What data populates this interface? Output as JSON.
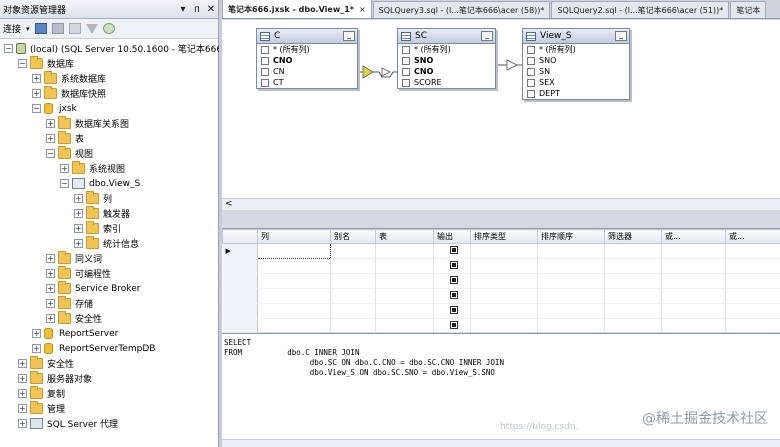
{
  "object_explorer": {
    "title": "对象资源管理器",
    "ctrl_pin": "▾",
    "ctrl_dock": "ᴨ",
    "ctrl_close": "✕",
    "connect_label": "连接",
    "tree": [
      {
        "label": "(local) (SQL Server 10.50.1600 - 笔记本666\\",
        "indent": 0,
        "exp": "−",
        "icon": "server"
      },
      {
        "label": "数据库",
        "indent": 1,
        "exp": "−",
        "icon": "folder"
      },
      {
        "label": "系统数据库",
        "indent": 2,
        "exp": "+",
        "icon": "folder"
      },
      {
        "label": "数据库快照",
        "indent": 2,
        "exp": "+",
        "icon": "folder"
      },
      {
        "label": "jxsk",
        "indent": 2,
        "exp": "−",
        "icon": "db"
      },
      {
        "label": "数据库关系图",
        "indent": 3,
        "exp": "+",
        "icon": "folder"
      },
      {
        "label": "表",
        "indent": 3,
        "exp": "+",
        "icon": "folder"
      },
      {
        "label": "视图",
        "indent": 3,
        "exp": "−",
        "icon": "folder"
      },
      {
        "label": "系统视图",
        "indent": 4,
        "exp": "+",
        "icon": "folder"
      },
      {
        "label": "dbo.View_S",
        "indent": 4,
        "exp": "−",
        "icon": "view"
      },
      {
        "label": "列",
        "indent": 5,
        "exp": "+",
        "icon": "folder"
      },
      {
        "label": "触发器",
        "indent": 5,
        "exp": "+",
        "icon": "folder"
      },
      {
        "label": "索引",
        "indent": 5,
        "exp": "+",
        "icon": "folder"
      },
      {
        "label": "统计信息",
        "indent": 5,
        "exp": "+",
        "icon": "folder"
      },
      {
        "label": "同义词",
        "indent": 3,
        "exp": "+",
        "icon": "folder"
      },
      {
        "label": "可编程性",
        "indent": 3,
        "exp": "+",
        "icon": "folder"
      },
      {
        "label": "Service Broker",
        "indent": 3,
        "exp": "+",
        "icon": "folder"
      },
      {
        "label": "存储",
        "indent": 3,
        "exp": "+",
        "icon": "folder"
      },
      {
        "label": "安全性",
        "indent": 3,
        "exp": "+",
        "icon": "folder"
      },
      {
        "label": "ReportServer",
        "indent": 2,
        "exp": "+",
        "icon": "db"
      },
      {
        "label": "ReportServerTempDB",
        "indent": 2,
        "exp": "+",
        "icon": "db"
      },
      {
        "label": "安全性",
        "indent": 1,
        "exp": "+",
        "icon": "folder"
      },
      {
        "label": "服务器对象",
        "indent": 1,
        "exp": "+",
        "icon": "folder"
      },
      {
        "label": "复制",
        "indent": 1,
        "exp": "+",
        "icon": "folder"
      },
      {
        "label": "管理",
        "indent": 1,
        "exp": "+",
        "icon": "folder"
      },
      {
        "label": "SQL Server 代理",
        "indent": 1,
        "exp": "+",
        "icon": "agent"
      }
    ]
  },
  "tabs": [
    {
      "label": "笔记本666.jxsk - dbo.View_1*",
      "active": true,
      "close": "×"
    },
    {
      "label": "SQLQuery3.sql - (l...笔记本666\\acer (58))*",
      "active": false
    },
    {
      "label": "SQLQuery2.sql - (l...笔记本666\\acer (51))*",
      "active": false
    },
    {
      "label": "笔记本",
      "active": false
    }
  ],
  "diagram": {
    "tables": [
      {
        "name": "C",
        "columns": [
          {
            "label": "* (所有列)",
            "bold": false
          },
          {
            "label": "CNO",
            "bold": true
          },
          {
            "label": "CN",
            "bold": false
          },
          {
            "label": "CT",
            "bold": false
          }
        ]
      },
      {
        "name": "SC",
        "columns": [
          {
            "label": "* (所有列)",
            "bold": false
          },
          {
            "label": "SNO",
            "bold": true
          },
          {
            "label": "CNO",
            "bold": true
          },
          {
            "label": "SCORE",
            "bold": false
          }
        ]
      },
      {
        "name": "View_S",
        "columns": [
          {
            "label": "* (所有列)",
            "bold": false
          },
          {
            "label": "SNO",
            "bold": false
          },
          {
            "label": "SN",
            "bold": false
          },
          {
            "label": "SEX",
            "bold": false
          },
          {
            "label": "DEPT",
            "bold": false
          }
        ]
      }
    ],
    "scroll_left": "<"
  },
  "grid": {
    "headers": [
      "",
      "列",
      "别名",
      "表",
      "输出",
      "排序类型",
      "排序顺序",
      "筛选器",
      "或...",
      "或..."
    ],
    "row_marker": "▶",
    "row_count": 6
  },
  "sql": {
    "lines": [
      "SELECT",
      "FROM          dbo.C INNER JOIN",
      "                   dbo.SC ON dbo.C.CNO = dbo.SC.CNO INNER JOIN",
      "                   dbo.View_S ON dbo.SC.SNO = dbo.View_S.SNO"
    ]
  },
  "watermark": "@稀土掘金技术社区",
  "watermark_url": "https://blog.csdn."
}
